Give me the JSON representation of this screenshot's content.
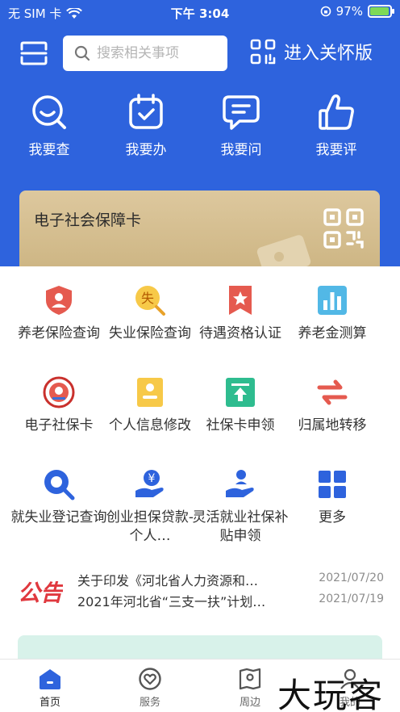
{
  "status_bar": {
    "carrier": "无 SIM 卡",
    "time": "下午 3:04",
    "battery": "97%",
    "battery_level": 0.97
  },
  "topnav": {
    "search_placeholder": "搜索相关事项",
    "care_label": "进入关怀版"
  },
  "quick_actions": [
    {
      "label": "我要查",
      "icon": "search-chat-icon"
    },
    {
      "label": "我要办",
      "icon": "calendar-check-icon"
    },
    {
      "label": "我要问",
      "icon": "message-icon"
    },
    {
      "label": "我要评",
      "icon": "thumbs-up-icon"
    }
  ],
  "card": {
    "title": "电子社会保障卡",
    "icon": "qr-code-icon"
  },
  "services": [
    {
      "label": "养老保险查询",
      "icon": "pension-shield-icon",
      "color": "#e55a4f"
    },
    {
      "label": "失业保险查询",
      "icon": "unemployment-icon",
      "color": "#f2b632",
      "glyph": "失"
    },
    {
      "label": "待遇资格认证",
      "icon": "certify-badge-icon",
      "color": "#e55a4f"
    },
    {
      "label": "养老金测算",
      "icon": "bar-chart-icon",
      "color": "#3ea7d9"
    },
    {
      "label": "电子社保卡",
      "icon": "emblem-icon",
      "color": "#d9534f"
    },
    {
      "label": "个人信息修改",
      "icon": "user-card-icon",
      "color": "#f2b632"
    },
    {
      "label": "社保卡申领",
      "icon": "apply-card-icon",
      "color": "#27b38a"
    },
    {
      "label": "归属地转移",
      "icon": "transfer-arrows-icon",
      "color": "#e55a4f"
    },
    {
      "label": "就失业登记查询",
      "icon": "magnifier-icon",
      "color": "#2e63dd"
    },
    {
      "label": "创业担保贷款-个人…",
      "icon": "loan-hand-icon",
      "color": "#2e63dd",
      "glyph": "¥"
    },
    {
      "label": "灵活就业社保补贴申领",
      "icon": "subsidy-hand-icon",
      "color": "#2e63dd"
    },
    {
      "label": "更多",
      "icon": "more-grid-icon",
      "color": "#2e63dd"
    }
  ],
  "notices": {
    "logo_text": "公告",
    "items": [
      {
        "text": "关于印发《河北省人力资源和…",
        "date": "2021/07/20"
      },
      {
        "text": "2021年河北省“三支一扶”计划…",
        "date": "2021/07/19"
      }
    ]
  },
  "tabs": [
    {
      "label": "首页",
      "icon": "home-icon",
      "active": true
    },
    {
      "label": "服务",
      "icon": "heart-circle-icon",
      "active": false
    },
    {
      "label": "周边",
      "icon": "map-location-icon",
      "active": false
    },
    {
      "label": "我的",
      "icon": "user-icon",
      "active": false
    }
  ],
  "watermark": "大玩客",
  "colors": {
    "brand_blue": "#2e63dd",
    "card_gold": "#d6bf8f",
    "promo_mint": "#d8f2ea"
  }
}
